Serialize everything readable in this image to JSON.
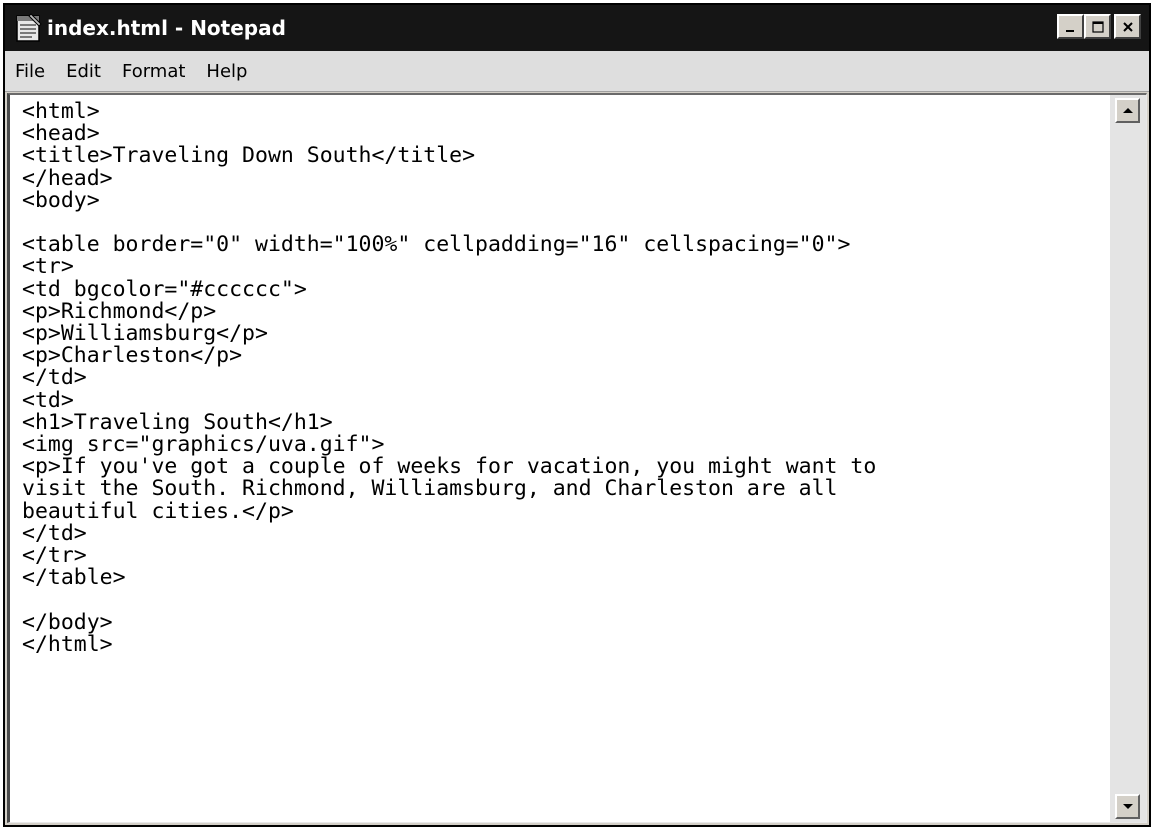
{
  "window": {
    "title": "index.html - Notepad",
    "app_icon": "notepad-icon",
    "controls": [
      "minimize-icon",
      "maximize-icon",
      "close-icon"
    ]
  },
  "menu": {
    "file": "File",
    "edit": "Edit",
    "format": "Format",
    "help": "Help"
  },
  "editor": {
    "text": "<html>\n<head>\n<title>Traveling Down South</title>\n</head>\n<body>\n\n<table border=\"0\" width=\"100%\" cellpadding=\"16\" cellspacing=\"0\">\n<tr>\n<td bgcolor=\"#cccccc\">\n<p>Richmond</p>\n<p>Williamsburg</p>\n<p>Charleston</p>\n</td>\n<td>\n<h1>Traveling South</h1>\n<img src=\"graphics/uva.gif\">\n<p>If you've got a couple of weeks for vacation, you might want to\nvisit the South. Richmond, Williamsburg, and Charleston are all\nbeautiful cities.</p>\n</td>\n</tr>\n</table>\n\n</body>\n</html>"
  },
  "scrollbar": {
    "up_icon": "scroll-up-arrow-icon",
    "down_icon": "scroll-down-arrow-icon"
  },
  "colors": {
    "titlebar": "#151515",
    "chrome": "#d4d0c8",
    "editor_bg": "#ffffff"
  }
}
